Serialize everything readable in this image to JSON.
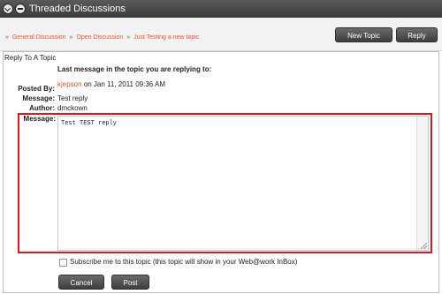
{
  "titlebar": {
    "title": "Threaded Discussions",
    "icon_left": "chevron-down-icon",
    "icon_right": "minus-icon"
  },
  "breadcrumb": {
    "items": [
      "General Discussion",
      "Open Discussion",
      "Just Testing a new topic"
    ],
    "separator": "»"
  },
  "toolbar": {
    "new_topic_label": "New Topic",
    "reply_label": "Reply"
  },
  "form": {
    "heading": "Reply To A Topic",
    "last_message_heading": "Last message in the topic you are replying to:",
    "posted_by_label": "Posted By:",
    "posted_by_user": "kjepson",
    "posted_by_date": "on Jan 11, 2011 09:36 AM",
    "message_label": "Message:",
    "message_value": "Test reply",
    "author_label": "Author:",
    "author_value": "dmckown",
    "reply_message_label": "Message:",
    "reply_message_value": "Test TEST reply",
    "subscribe_text": "Subscribe me to this topic (this topic will show in your Web@work InBox)",
    "subscribe_checked": false,
    "cancel_label": "Cancel",
    "post_label": "Post"
  },
  "colors": {
    "link": "#e2572e",
    "highlight": "#d81920",
    "button": "#4a4a4a"
  }
}
